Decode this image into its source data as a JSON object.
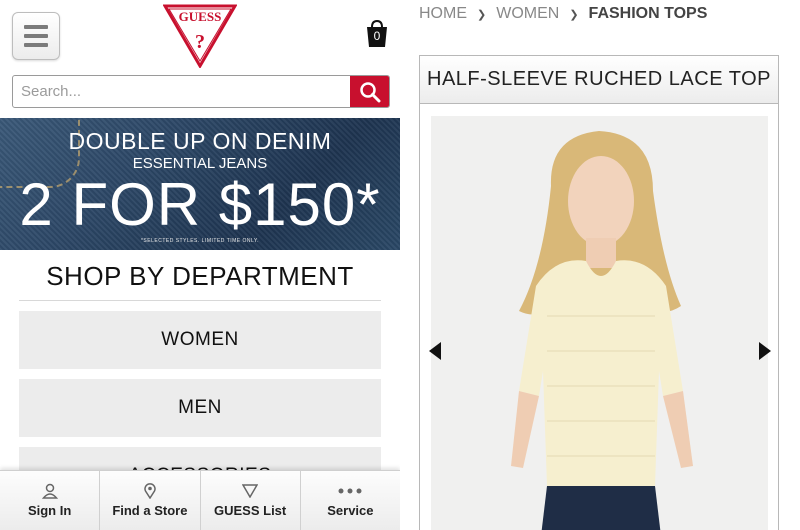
{
  "header": {
    "logo_text": "GUESS",
    "cart_count": "0"
  },
  "search": {
    "placeholder": "Search..."
  },
  "promo": {
    "line1": "DOUBLE UP ON DENIM",
    "line2": "ESSENTIAL JEANS",
    "big": "2 FOR $150*",
    "fine_print": "*SELECTED STYLES. LIMITED TIME ONLY."
  },
  "shop": {
    "title": "SHOP BY DEPARTMENT",
    "departments": [
      "WOMEN",
      "MEN",
      "ACCESSORIES"
    ]
  },
  "tabbar": {
    "items": [
      {
        "label": "Sign In",
        "icon": "person-icon"
      },
      {
        "label": "Find a Store",
        "icon": "location-pin-icon"
      },
      {
        "label": "GUESS List",
        "icon": "triangle-icon"
      },
      {
        "label": "Service",
        "icon": "more-dots-icon"
      }
    ]
  },
  "breadcrumb": {
    "items": [
      "HOME",
      "WOMEN",
      "FASHION TOPS"
    ]
  },
  "product": {
    "title": "HALF-SLEEVE RUCHED LACE TOP"
  },
  "colors": {
    "accent_red": "#c8102e",
    "denim_blue": "#2c4766"
  }
}
